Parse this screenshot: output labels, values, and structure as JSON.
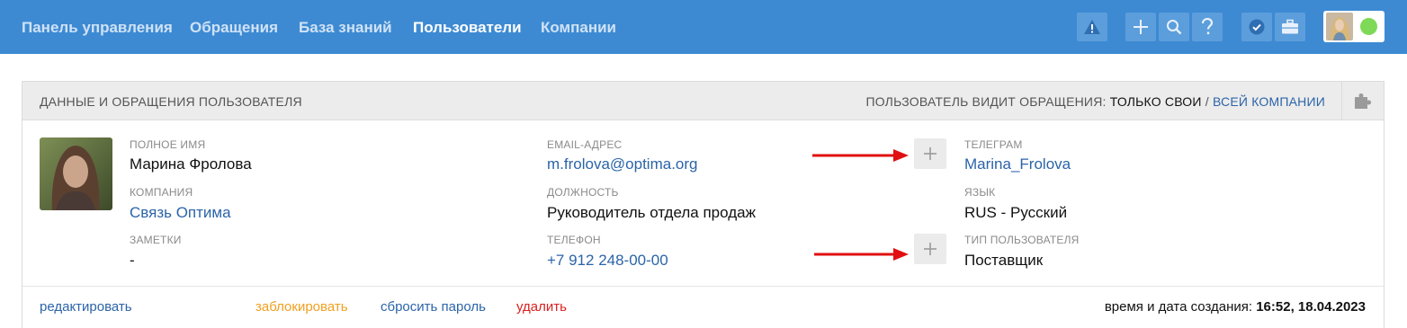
{
  "nav": {
    "items": [
      {
        "label": "Панель управления",
        "active": false
      },
      {
        "label": "Обращения",
        "active": false
      },
      {
        "label": "База знаний",
        "active": false
      },
      {
        "label": "Пользователи",
        "active": true
      },
      {
        "label": "Компании",
        "active": false
      }
    ],
    "tools": [
      "warning-icon",
      "plus-icon",
      "search-icon",
      "question-icon",
      "verified-icon",
      "briefcase-icon"
    ],
    "status_color": "#7ed957"
  },
  "panel": {
    "title": "ДАННЫЕ И ОБРАЩЕНИЯ ПОЛЬЗОВАТЕЛЯ",
    "visibility_prefix": "ПОЛЬЗОВАТЕЛЬ ВИДИТ ОБРАЩЕНИЯ:",
    "visibility_own": "ТОЛЬКО СВОИ",
    "visibility_sep": "/",
    "visibility_company": "ВСЕЙ КОМПАНИИ"
  },
  "profile": {
    "full_name_label": "ПОЛНОЕ ИМЯ",
    "full_name": "Марина Фролова",
    "company_label": "КОМПАНИЯ",
    "company": "Связь Оптима",
    "notes_label": "ЗАМЕТКИ",
    "notes": "-",
    "email_label": "EMAIL-АДРЕС",
    "email": "m.frolova@optima.org",
    "position_label": "ДОЛЖНОСТЬ",
    "position": "Руководитель отдела продаж",
    "phone_label": "ТЕЛЕФОН",
    "phone": "+7 912 248-00-00",
    "telegram_label": "ТЕЛЕГРАМ",
    "telegram": "Marina_Frolova",
    "language_label": "ЯЗЫК",
    "language": "RUS - Русский",
    "user_type_label": "ТИП ПОЛЬЗОВАТЕЛЯ",
    "user_type": "Поставщик"
  },
  "actions": {
    "edit": "редактировать",
    "block": "заблокировать",
    "reset_password": "сбросить пароль",
    "delete": "удалить"
  },
  "created": {
    "label": "время и дата создания:",
    "value": "16:52, 18.04.2023"
  },
  "colors": {
    "topbar": "#3d8ad3",
    "link": "#2b64a8",
    "block": "#f0a020",
    "delete": "#d9201e",
    "arrow": "#e01010"
  }
}
